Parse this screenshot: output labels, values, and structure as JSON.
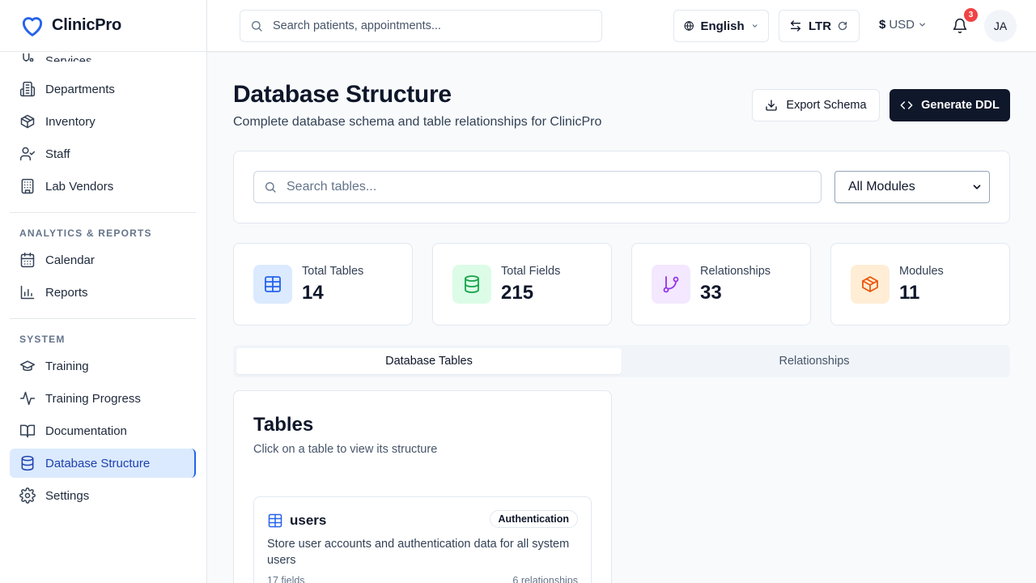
{
  "app": {
    "name": "ClinicPro",
    "brand_color": "#2563eb"
  },
  "sidebar": {
    "partial_item": {
      "label": "Services",
      "icon": "stethoscope-icon"
    },
    "group1": [
      {
        "label": "Departments",
        "icon": "building-icon"
      },
      {
        "label": "Inventory",
        "icon": "package-icon"
      },
      {
        "label": "Staff",
        "icon": "user-check-icon"
      },
      {
        "label": "Lab Vendors",
        "icon": "office-building-icon"
      }
    ],
    "analytics_heading": "ANALYTICS & REPORTS",
    "analytics": [
      {
        "label": "Calendar",
        "icon": "calendar-icon"
      },
      {
        "label": "Reports",
        "icon": "bar-chart-icon"
      }
    ],
    "system_heading": "SYSTEM",
    "system": [
      {
        "label": "Training",
        "icon": "graduation-cap-icon"
      },
      {
        "label": "Training Progress",
        "icon": "activity-icon"
      },
      {
        "label": "Documentation",
        "icon": "book-open-icon"
      },
      {
        "label": "Database Structure",
        "icon": "database-icon",
        "active": true
      },
      {
        "label": "Settings",
        "icon": "gear-icon"
      }
    ]
  },
  "topbar": {
    "search_placeholder": "Search patients, appointments...",
    "language": "English",
    "direction": "LTR",
    "currency_symbol": "$",
    "currency_code": "USD",
    "notifications_count": "3",
    "avatar_initials": "JA"
  },
  "page": {
    "title": "Database Structure",
    "subtitle": "Complete database schema and table relationships for ClinicPro",
    "export_label": "Export Schema",
    "generate_label": "Generate DDL"
  },
  "filters": {
    "search_placeholder": "Search tables...",
    "module_selected": "All Modules"
  },
  "stats": [
    {
      "label": "Total Tables",
      "value": "14",
      "icon": "table-icon",
      "color": "#2563eb",
      "bg": "#dbeafe"
    },
    {
      "label": "Total Fields",
      "value": "215",
      "icon": "database-icon",
      "color": "#16a34a",
      "bg": "#dcfce7"
    },
    {
      "label": "Relationships",
      "value": "33",
      "icon": "git-branch-icon",
      "color": "#9333ea",
      "bg": "#f3e8ff"
    },
    {
      "label": "Modules",
      "value": "11",
      "icon": "package-icon",
      "color": "#ea580c",
      "bg": "#ffedd5"
    }
  ],
  "tabs": [
    {
      "label": "Database Tables",
      "active": true
    },
    {
      "label": "Relationships",
      "active": false
    }
  ],
  "tables_card": {
    "title": "Tables",
    "subtitle": "Click on a table to view its structure",
    "items": [
      {
        "name": "users",
        "module": "Authentication",
        "description": "Store user accounts and authentication data for all system users",
        "fields": "17 fields",
        "relationships": "6 relationships"
      }
    ]
  }
}
